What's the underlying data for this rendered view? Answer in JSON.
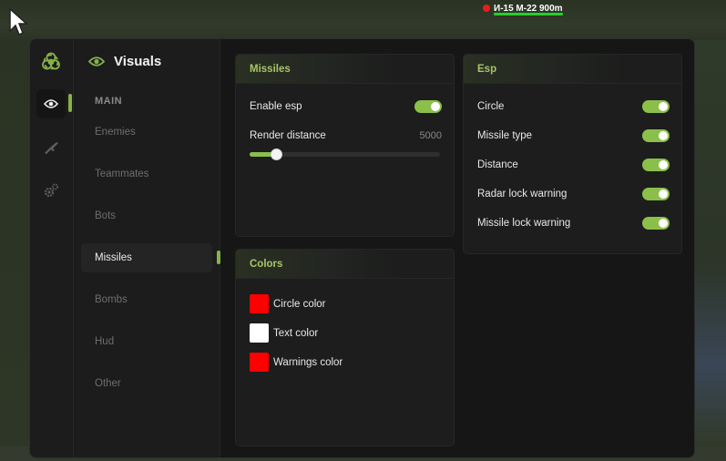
{
  "hud": {
    "label": "И-15 М-22 900m",
    "marker_color": "#e02020",
    "bar_color": "#22d12b"
  },
  "sidebar": {
    "title": "Visuals",
    "section": "MAIN",
    "items": [
      {
        "label": "Enemies"
      },
      {
        "label": "Teammates"
      },
      {
        "label": "Bots"
      },
      {
        "label": "Missiles",
        "active": true
      },
      {
        "label": "Bombs"
      },
      {
        "label": "Hud"
      },
      {
        "label": "Other"
      }
    ]
  },
  "rail": {
    "icons": [
      "biohazard-icon",
      "eye-icon",
      "rifle-icon",
      "gears-icon"
    ],
    "active": "eye-icon"
  },
  "missiles_panel": {
    "title": "Missiles",
    "enable_esp": {
      "label": "Enable esp",
      "on": true
    },
    "render_distance": {
      "label": "Render distance",
      "value": "5000",
      "fill_fraction": 0.14
    }
  },
  "esp_panel": {
    "title": "Esp",
    "toggles": [
      {
        "label": "Circle",
        "on": true
      },
      {
        "label": "Missile type",
        "on": true
      },
      {
        "label": "Distance",
        "on": true
      },
      {
        "label": "Radar lock warning",
        "on": true
      },
      {
        "label": "Missile lock warning",
        "on": true
      }
    ]
  },
  "colors_panel": {
    "title": "Colors",
    "items": [
      {
        "label": "Circle color",
        "color": "#ff0000"
      },
      {
        "label": "Text color",
        "color": "#ffffff"
      },
      {
        "label": "Warnings color",
        "color": "#ff0000"
      }
    ]
  },
  "theme": {
    "accent": "#8cbf4a",
    "heading": "#a8c566",
    "window_bg": "#1b1c1b",
    "panel_bg": "#1c1d1c"
  }
}
